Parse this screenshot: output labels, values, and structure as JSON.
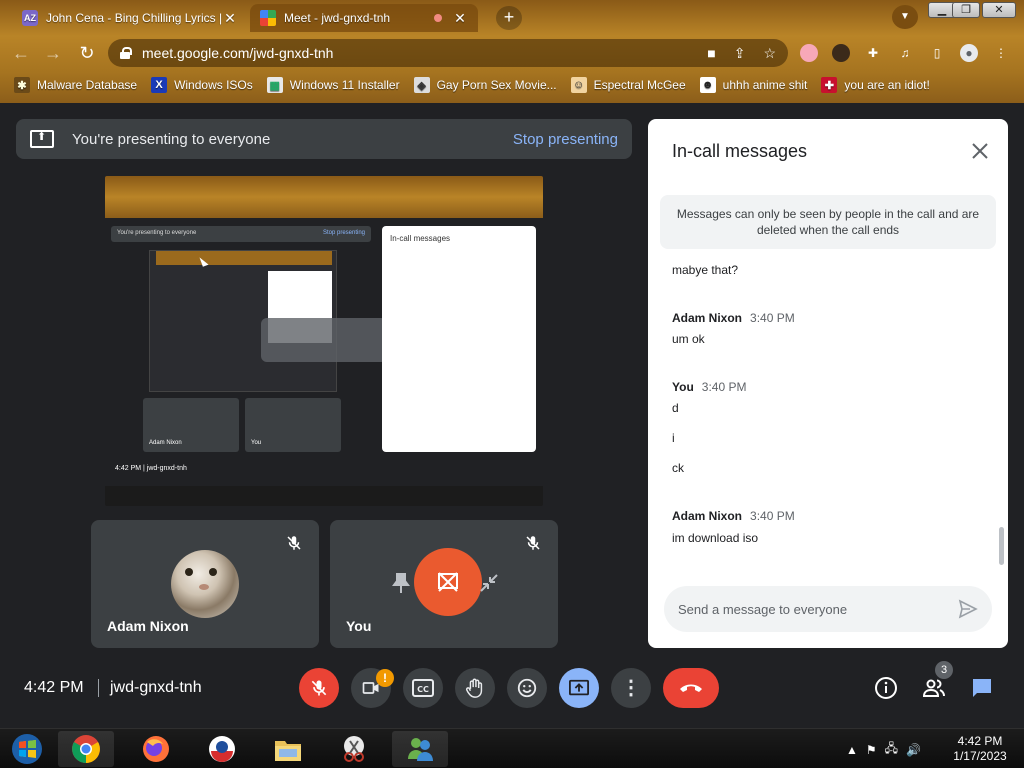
{
  "browser": {
    "tabs": [
      {
        "title": "John Cena - Bing Chilling Lyrics |",
        "favicon_text": "AZ",
        "active": false
      },
      {
        "title": "Meet - jwd-gnxd-tnh",
        "active": true
      }
    ],
    "url": "meet.google.com/jwd-gnxd-tnh",
    "bookmarks": [
      {
        "label": "Malware Database",
        "icon": "bug-icon"
      },
      {
        "label": "Windows ISOs",
        "icon": "x-icon"
      },
      {
        "label": "Windows 11 Installer",
        "icon": "picture-icon"
      },
      {
        "label": "Gay Porn Sex Movie...",
        "icon": "cube-icon"
      },
      {
        "label": "Espectral McGee",
        "icon": "face-icon"
      },
      {
        "label": "uhhh anime shit",
        "icon": "anime-icon"
      },
      {
        "label": "you are an idiot!",
        "icon": "flag-icon"
      }
    ]
  },
  "meet": {
    "banner": {
      "text": "You're presenting to everyone",
      "stop_label": "Stop presenting"
    },
    "participants": [
      {
        "name": "Adam Nixon",
        "muted": true
      },
      {
        "name": "You",
        "muted": true
      }
    ],
    "clock": "4:42 PM",
    "meeting_code": "jwd-gnxd-tnh",
    "participant_count": "3",
    "camera_warning": "!",
    "colors": {
      "accent": "#8ab4f8",
      "danger": "#ea4335",
      "present": "#ea5a2f"
    }
  },
  "chat": {
    "title": "In-call messages",
    "notice": "Messages can only be seen by people in the call and are deleted when the call ends",
    "messages": [
      {
        "text": "mabye that?"
      },
      {
        "sender": "Adam Nixon",
        "time": "3:40 PM",
        "text": "um ok"
      },
      {
        "sender": "You",
        "time": "3:40 PM",
        "lines": [
          "d",
          "i",
          "ck"
        ]
      },
      {
        "sender": "Adam Nixon",
        "time": "3:40 PM",
        "text": "im download iso"
      }
    ],
    "placeholder": "Send a message to everyone"
  },
  "screenshare": {
    "banner": "You're presenting to everyone",
    "stop": "Stop presenting",
    "chat_title": "In-call messages",
    "clock": "4:42 PM",
    "code": "jwd-gnxd-tnh",
    "tiles": [
      "Adam Nixon",
      "You"
    ]
  },
  "taskbar": {
    "time": "4:42 PM",
    "date": "1/17/2023"
  }
}
